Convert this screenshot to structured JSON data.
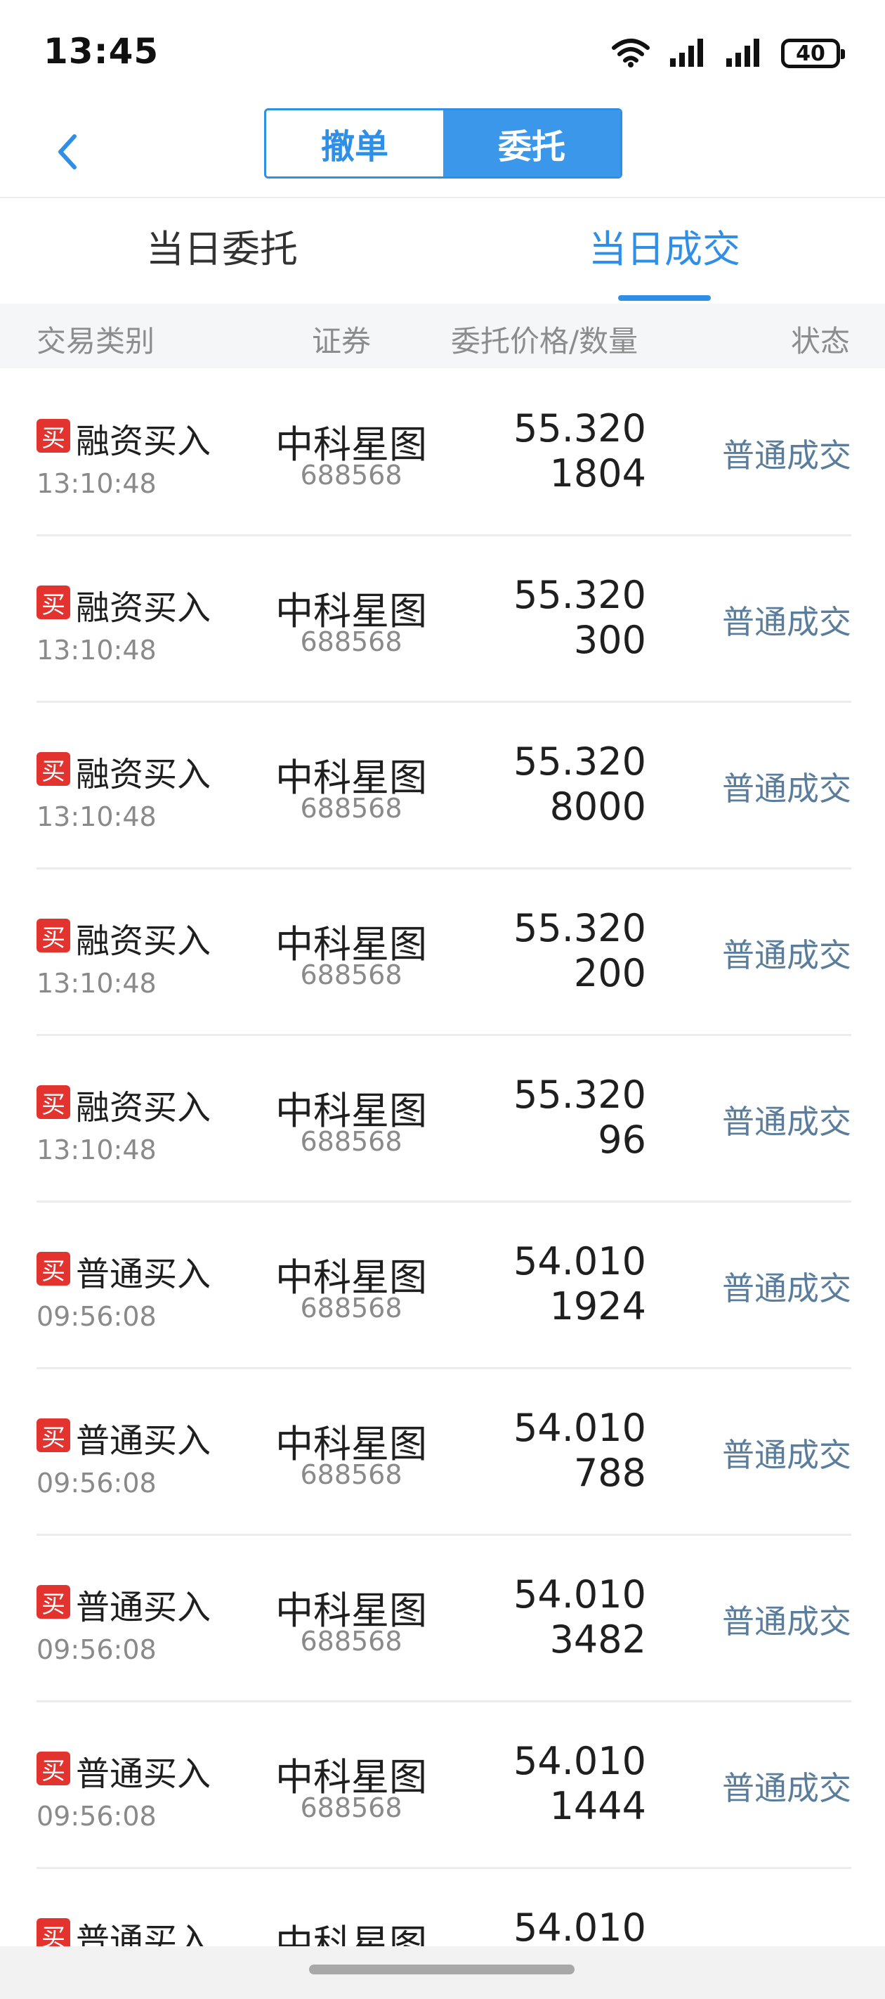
{
  "status_bar": {
    "time": "13:45",
    "battery": "40",
    "icons": [
      "wifi-icon",
      "signal-icon",
      "signal-icon",
      "battery-icon"
    ]
  },
  "header": {
    "back_icon": "chevron-left-icon",
    "segments": [
      "撤单",
      "委托"
    ],
    "active_segment": "委托"
  },
  "tabs": {
    "items": [
      "当日委托",
      "当日成交"
    ],
    "active": "当日成交"
  },
  "columns": {
    "type": "交易类别",
    "security": "证券",
    "price_qty": "委托价格/数量",
    "status": "状态"
  },
  "rows": [
    {
      "badge": "买",
      "type": "融资买入",
      "time": "13:10:48",
      "name": "中科星图",
      "code": "688568",
      "price": "55.320",
      "qty": "1804",
      "status": "普通成交"
    },
    {
      "badge": "买",
      "type": "融资买入",
      "time": "13:10:48",
      "name": "中科星图",
      "code": "688568",
      "price": "55.320",
      "qty": "300",
      "status": "普通成交"
    },
    {
      "badge": "买",
      "type": "融资买入",
      "time": "13:10:48",
      "name": "中科星图",
      "code": "688568",
      "price": "55.320",
      "qty": "8000",
      "status": "普通成交"
    },
    {
      "badge": "买",
      "type": "融资买入",
      "time": "13:10:48",
      "name": "中科星图",
      "code": "688568",
      "price": "55.320",
      "qty": "200",
      "status": "普通成交"
    },
    {
      "badge": "买",
      "type": "融资买入",
      "time": "13:10:48",
      "name": "中科星图",
      "code": "688568",
      "price": "55.320",
      "qty": "96",
      "status": "普通成交"
    },
    {
      "badge": "买",
      "type": "普通买入",
      "time": "09:56:08",
      "name": "中科星图",
      "code": "688568",
      "price": "54.010",
      "qty": "1924",
      "status": "普通成交"
    },
    {
      "badge": "买",
      "type": "普通买入",
      "time": "09:56:08",
      "name": "中科星图",
      "code": "688568",
      "price": "54.010",
      "qty": "788",
      "status": "普通成交"
    },
    {
      "badge": "买",
      "type": "普通买入",
      "time": "09:56:08",
      "name": "中科星图",
      "code": "688568",
      "price": "54.010",
      "qty": "3482",
      "status": "普通成交"
    },
    {
      "badge": "买",
      "type": "普通买入",
      "time": "09:56:08",
      "name": "中科星图",
      "code": "688568",
      "price": "54.010",
      "qty": "1444",
      "status": "普通成交"
    },
    {
      "badge": "买",
      "type": "普通买入",
      "time": "",
      "name": "中科星图",
      "code": "",
      "price": "54.010",
      "qty": "",
      "status": ""
    }
  ],
  "colors": {
    "accent": "#2f8ee6",
    "buy_badge": "#e2332f",
    "status_text": "#5b7d9c"
  }
}
